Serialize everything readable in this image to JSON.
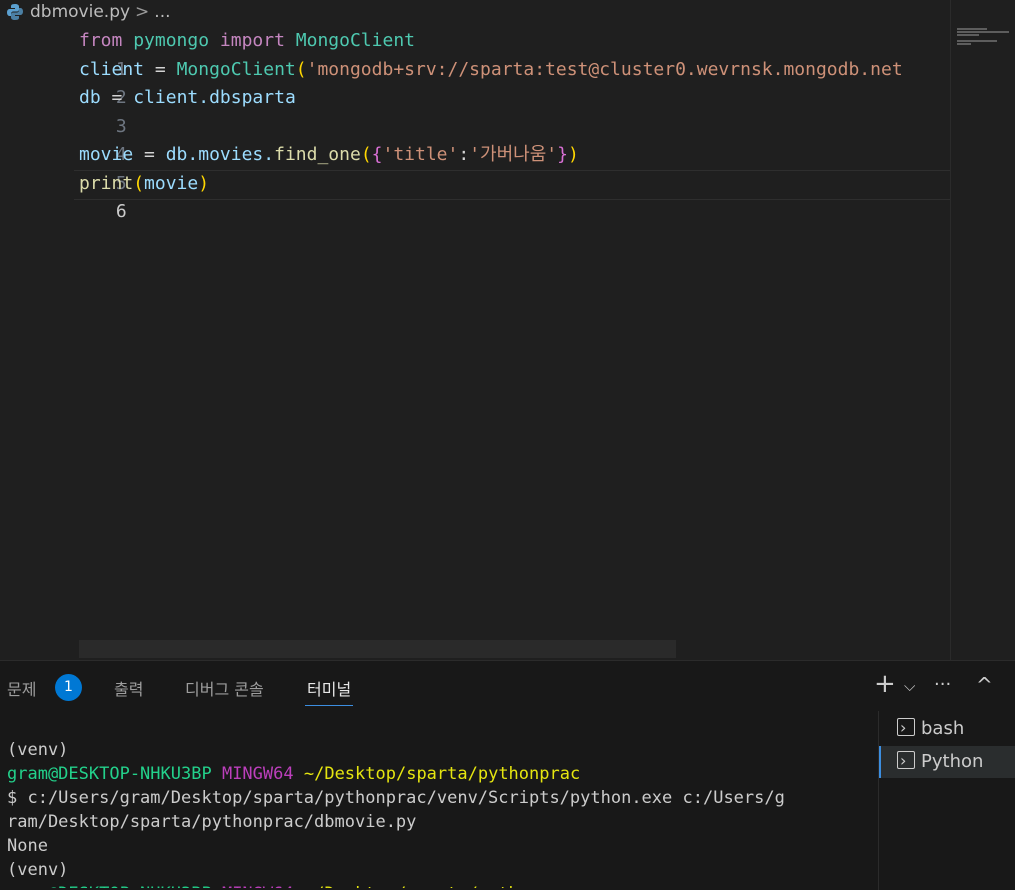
{
  "breadcrumb": {
    "file": "dbmovie.py",
    "separator": ">",
    "more": "..."
  },
  "editor": {
    "line_numbers": [
      "1",
      "2",
      "3",
      "4",
      "5",
      "6"
    ],
    "lines": {
      "l1": [
        "from",
        "pymongo",
        "import",
        "MongoClient"
      ],
      "l2": [
        "client",
        "=",
        "MongoClient",
        "(",
        "'mongodb+srv://sparta:test@cluster0.wevrnsk.mongodb.net"
      ],
      "l3": [
        "db",
        "=",
        "client",
        ".dbsparta"
      ],
      "l5": [
        "movie",
        "=",
        "db",
        ".movies.",
        "find_one",
        "(",
        "{",
        "'title'",
        ":",
        "'가버나움'",
        "}",
        ")"
      ],
      "l6": [
        "print",
        "(",
        "movie",
        ")"
      ]
    }
  },
  "panel": {
    "tabs": [
      "문제",
      "출력",
      "디버그 콘솔",
      "터미널"
    ],
    "problems_count": "1",
    "toolbar": {
      "add": "+",
      "dropdown": "⌵",
      "more": "···",
      "collapse": "^"
    }
  },
  "terminal": {
    "lines": [
      "(venv)",
      "gram@DESKTOP-NHKU3BP",
      "MINGW64",
      "~/Desktop/sparta/pythonprac",
      "$ c:/Users/gram/Desktop/sparta/pythonprac/venv/Scripts/python.exe c:/Users/g",
      "ram/Desktop/sparta/pythonprac/dbmovie.py",
      "None",
      "(venv)"
    ],
    "sessions": [
      "bash",
      "Python"
    ]
  },
  "colors": {
    "accent": "#0078d4",
    "background": "#1f1f1f",
    "panel": "#181818"
  }
}
